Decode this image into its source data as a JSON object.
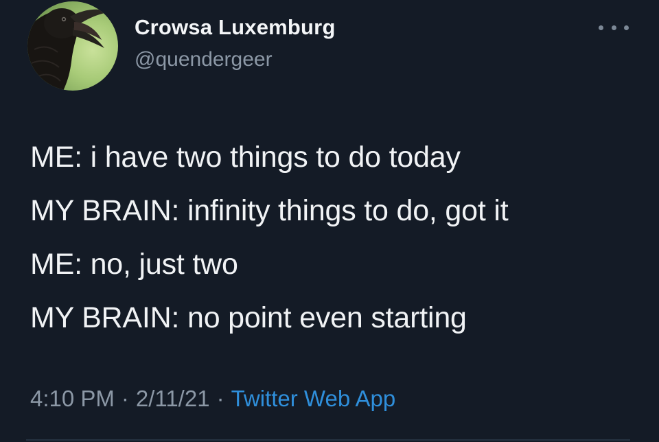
{
  "author": {
    "display_name": "Crowsa Luxemburg",
    "handle": "@quendergeer",
    "avatar_icon": "crow-avatar-icon"
  },
  "more_icon": "more-options-icon",
  "tweet": {
    "lines": [
      "ME: i have two things to do today",
      "MY BRAIN: infinity things to do, got it",
      "ME: no, just two",
      "MY BRAIN: no point even starting"
    ]
  },
  "meta": {
    "time": "4:10 PM",
    "separator": "·",
    "date": "2/11/21",
    "source": "Twitter Web App"
  },
  "colors": {
    "background": "#141b26",
    "text": "#f1f3f5",
    "secondary": "#8c98a6",
    "link": "#2f8fdb"
  }
}
